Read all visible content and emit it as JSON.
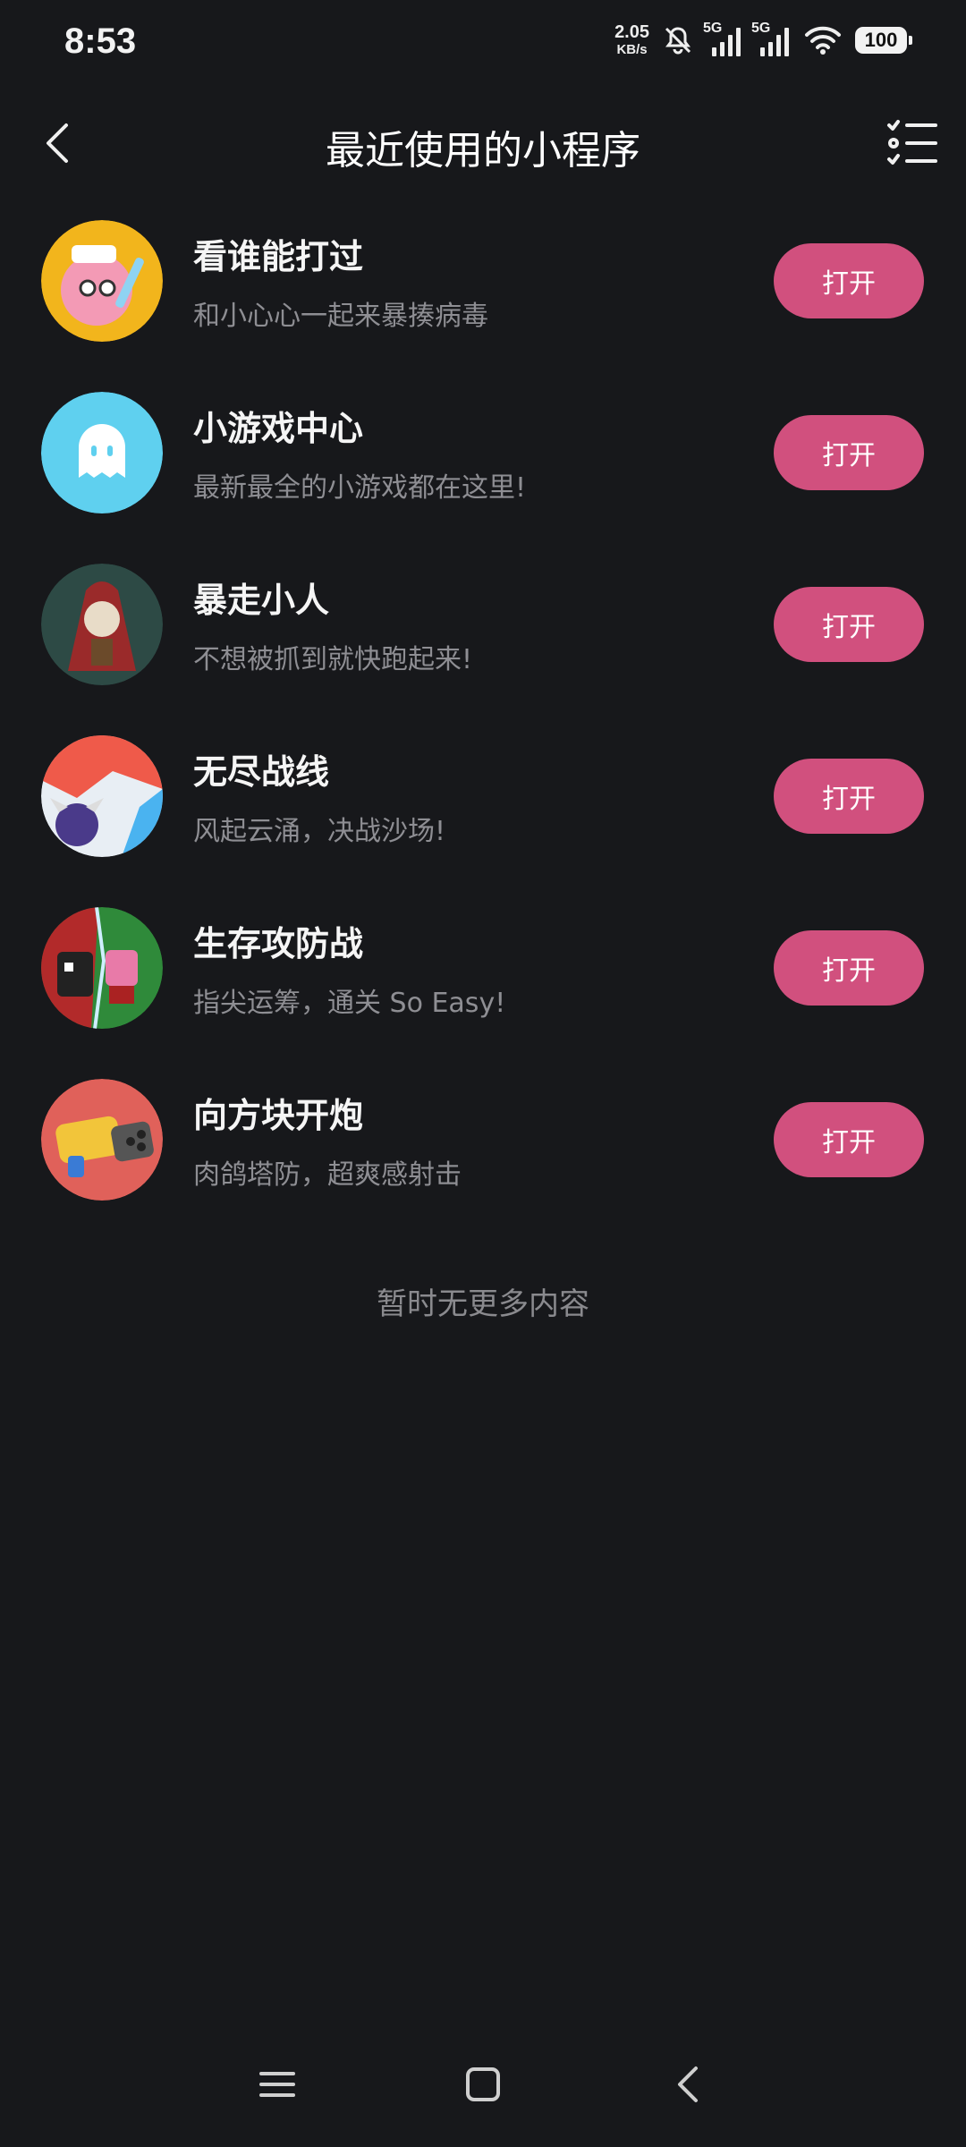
{
  "status": {
    "time": "8:53",
    "net_speed_value": "2.05",
    "net_speed_unit": "KB/s",
    "sim1": "5G",
    "sim2": "5G",
    "battery": "100"
  },
  "header": {
    "title": "最近使用的小程序"
  },
  "items": [
    {
      "name": "看谁能打过",
      "desc": "和小心心一起来暴揍病毒",
      "button": "打开"
    },
    {
      "name": "小游戏中心",
      "desc": "最新最全的小游戏都在这里!",
      "button": "打开"
    },
    {
      "name": "暴走小人",
      "desc": "不想被抓到就快跑起来!",
      "button": "打开"
    },
    {
      "name": "无尽战线",
      "desc": "风起云涌，决战沙场!",
      "button": "打开"
    },
    {
      "name": "生存攻防战",
      "desc": "指尖运筹，通关 So Easy!",
      "button": "打开"
    },
    {
      "name": "向方块开炮",
      "desc": "肉鸽塔防，超爽感射击",
      "button": "打开"
    }
  ],
  "footer": {
    "note": "暂时无更多内容"
  },
  "colors": {
    "background": "#17181b",
    "accent": "#d1507e",
    "secondary_text": "#8e8e93"
  },
  "icons": {
    "back": "chevron-left-icon",
    "manage": "checklist-icon",
    "sys_menu": "menu-icon",
    "sys_home": "square-home-icon",
    "sys_back": "back-triangle-icon"
  }
}
